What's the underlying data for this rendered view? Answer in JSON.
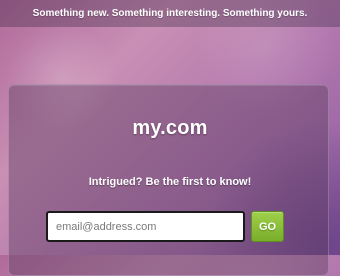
{
  "header": {
    "tagline": "Something new. Something interesting. Something yours."
  },
  "main": {
    "brand": "my.com",
    "subheading": "Intrigued? Be the first to know!",
    "email_placeholder": "email@address.com",
    "email_value": "",
    "go_label": "GO"
  },
  "colors": {
    "go_button": "#8cc63f",
    "panel_overlay": "#5a3c5f",
    "background_primary": "#c98fb4",
    "background_secondary": "#8a5a9e"
  }
}
